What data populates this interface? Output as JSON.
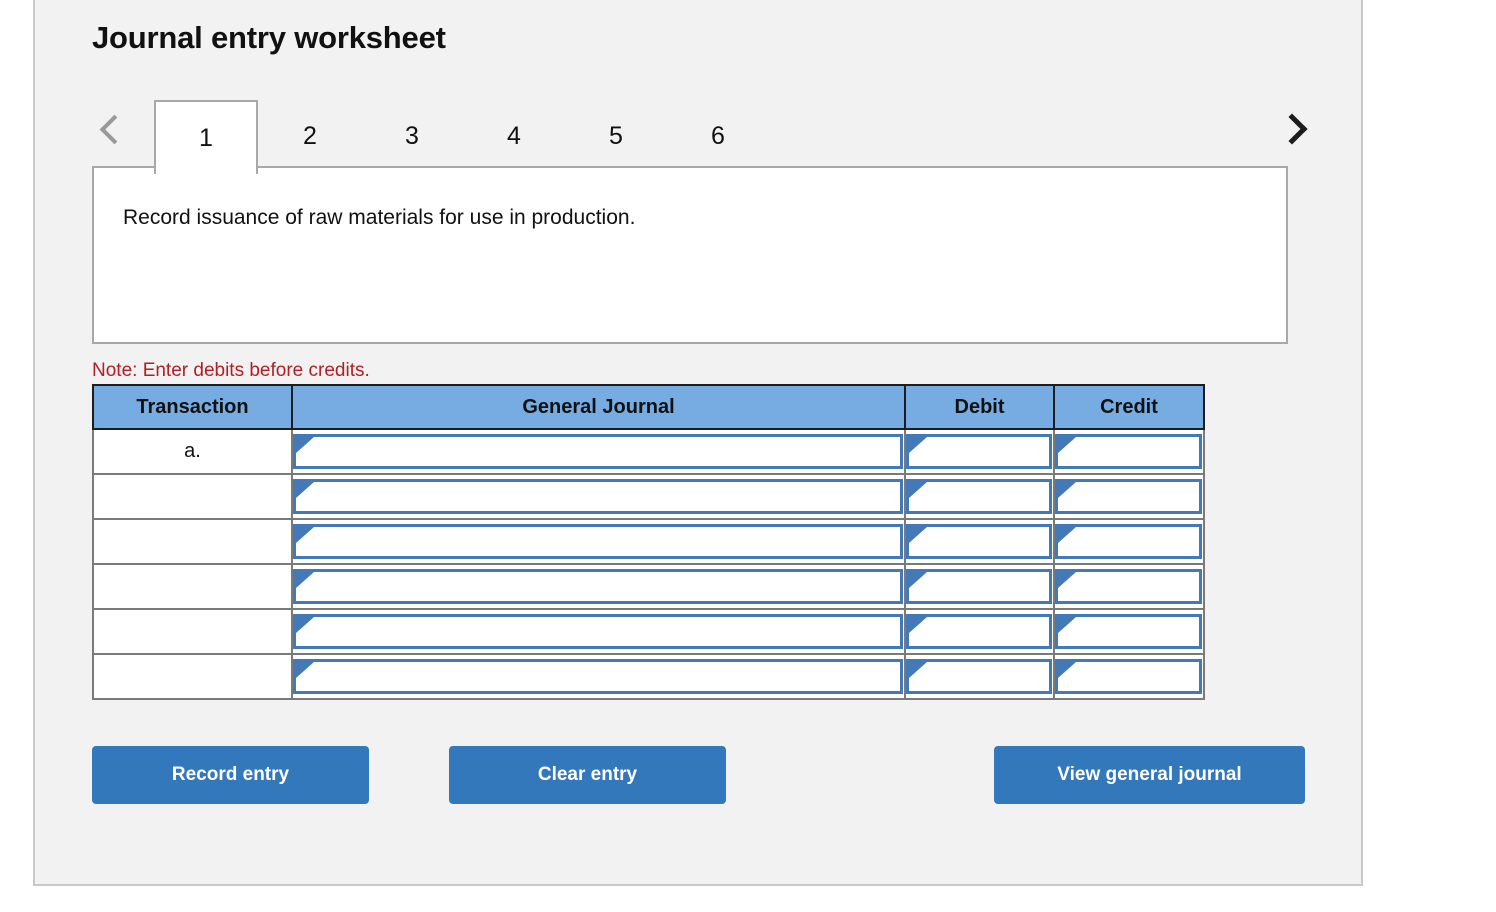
{
  "card": {
    "title": "Journal entry worksheet"
  },
  "nav": {
    "prev_icon": "chevron-left-icon",
    "next_icon": "chevron-right-icon",
    "prev_enabled": false,
    "next_enabled": true
  },
  "tabs": {
    "active_index": 0,
    "items": [
      {
        "label": "1"
      },
      {
        "label": "2"
      },
      {
        "label": "3"
      },
      {
        "label": "4"
      },
      {
        "label": "5"
      },
      {
        "label": "6"
      }
    ]
  },
  "description": {
    "text": "Record issuance of raw materials for use in production."
  },
  "note": {
    "text": "Note: Enter debits before credits."
  },
  "table": {
    "headers": {
      "transaction": "Transaction",
      "general_journal": "General Journal",
      "debit": "Debit",
      "credit": "Credit"
    },
    "rows": [
      {
        "transaction": "a.",
        "general_journal": "",
        "debit": "",
        "credit": ""
      },
      {
        "transaction": "",
        "general_journal": "",
        "debit": "",
        "credit": ""
      },
      {
        "transaction": "",
        "general_journal": "",
        "debit": "",
        "credit": ""
      },
      {
        "transaction": "",
        "general_journal": "",
        "debit": "",
        "credit": ""
      },
      {
        "transaction": "",
        "general_journal": "",
        "debit": "",
        "credit": ""
      },
      {
        "transaction": "",
        "general_journal": "",
        "debit": "",
        "credit": ""
      }
    ]
  },
  "buttons": {
    "record_entry": "Record entry",
    "clear_entry": "Clear entry",
    "view_general_journal": "View general journal"
  },
  "colors": {
    "card_background": "#f2f2f2",
    "card_border": "#c9c9c9",
    "header_blue": "#76ace2",
    "input_border_blue": "#4479b8",
    "button_blue": "#3378bb",
    "note_red": "#b01f24",
    "text_dark": "#111111"
  }
}
